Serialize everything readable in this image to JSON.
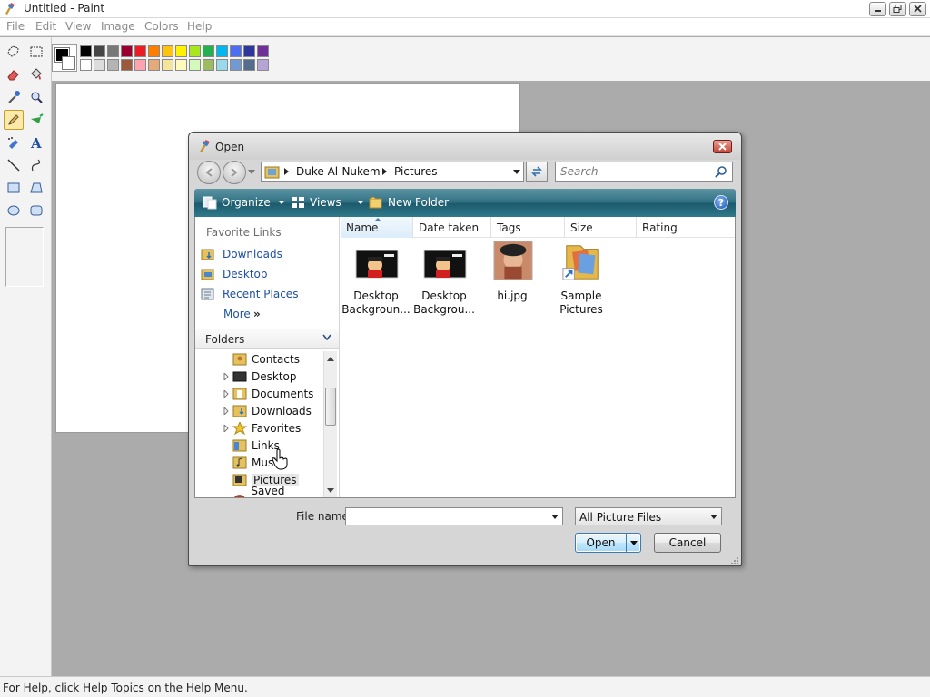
{
  "window": {
    "title": "Untitled - Paint"
  },
  "menu": [
    "File",
    "Edit",
    "View",
    "Image",
    "Colors",
    "Help"
  ],
  "tools": [
    {
      "name": "free-form-select-icon"
    },
    {
      "name": "rect-select-icon"
    },
    {
      "name": "eraser-icon"
    },
    {
      "name": "fill-bucket-icon"
    },
    {
      "name": "color-picker-icon"
    },
    {
      "name": "magnifier-icon"
    },
    {
      "name": "pencil-icon",
      "selected": true
    },
    {
      "name": "brush-icon"
    },
    {
      "name": "airbrush-icon"
    },
    {
      "name": "text-icon"
    },
    {
      "name": "line-icon"
    },
    {
      "name": "curve-icon"
    },
    {
      "name": "rectangle-icon"
    },
    {
      "name": "polygon-icon"
    },
    {
      "name": "ellipse-icon"
    },
    {
      "name": "rounded-rect-icon"
    }
  ],
  "palette": {
    "foreground": "#000000",
    "background": "#ffffff",
    "row1": [
      "#000000",
      "#464646",
      "#787878",
      "#990030",
      "#ed1c24",
      "#ff7e00",
      "#ffc20e",
      "#fff200",
      "#a8e61d",
      "#22b14c",
      "#00b7ef",
      "#4d6df3",
      "#2f3699",
      "#6f3198"
    ],
    "row2": [
      "#ffffff",
      "#dcdcdc",
      "#b4b4b4",
      "#9c5a3c",
      "#ffa3b1",
      "#e5aa7a",
      "#f5e49c",
      "#fff9bd",
      "#d3f9bc",
      "#9dbb61",
      "#99d9ea",
      "#709ad1",
      "#546d8e",
      "#b5a5d5"
    ]
  },
  "status": {
    "text": "For Help, click Help Topics on the Help Menu."
  },
  "dialog": {
    "title": "Open",
    "breadcrumb": [
      "Duke Al-Nukem",
      "Pictures"
    ],
    "search_placeholder": "Search",
    "commands": {
      "organize": "Organize",
      "views": "Views",
      "new_folder": "New Folder"
    },
    "favorites_header": "Favorite Links",
    "favorites": [
      "Downloads",
      "Desktop",
      "Recent Places"
    ],
    "more": "More",
    "folders_header": "Folders",
    "tree": [
      {
        "label": "Contacts",
        "expandable": false
      },
      {
        "label": "Desktop",
        "expandable": true
      },
      {
        "label": "Documents",
        "expandable": true
      },
      {
        "label": "Downloads",
        "expandable": true
      },
      {
        "label": "Favorites",
        "expandable": true
      },
      {
        "label": "Links",
        "expandable": false
      },
      {
        "label": "Music",
        "expandable": false
      },
      {
        "label": "Pictures",
        "expandable": false,
        "selected": true
      },
      {
        "label": "Saved Games",
        "expandable": false
      }
    ],
    "columns": [
      "Name",
      "Date taken",
      "Tags",
      "Size",
      "Rating"
    ],
    "files": [
      {
        "name_line1": "Desktop",
        "name_line2": "Backgroun...",
        "type": "image-dark"
      },
      {
        "name_line1": "Desktop",
        "name_line2": "Backgrou...",
        "type": "image-dark"
      },
      {
        "name_line1": "hi.jpg",
        "name_line2": "",
        "type": "image-photo"
      },
      {
        "name_line1": "Sample",
        "name_line2": "Pictures",
        "type": "folder-shortcut"
      }
    ],
    "file_name_label": "File name:",
    "file_name_value": "",
    "filter": "All Picture Files",
    "open_button": "Open",
    "cancel_button": "Cancel"
  }
}
